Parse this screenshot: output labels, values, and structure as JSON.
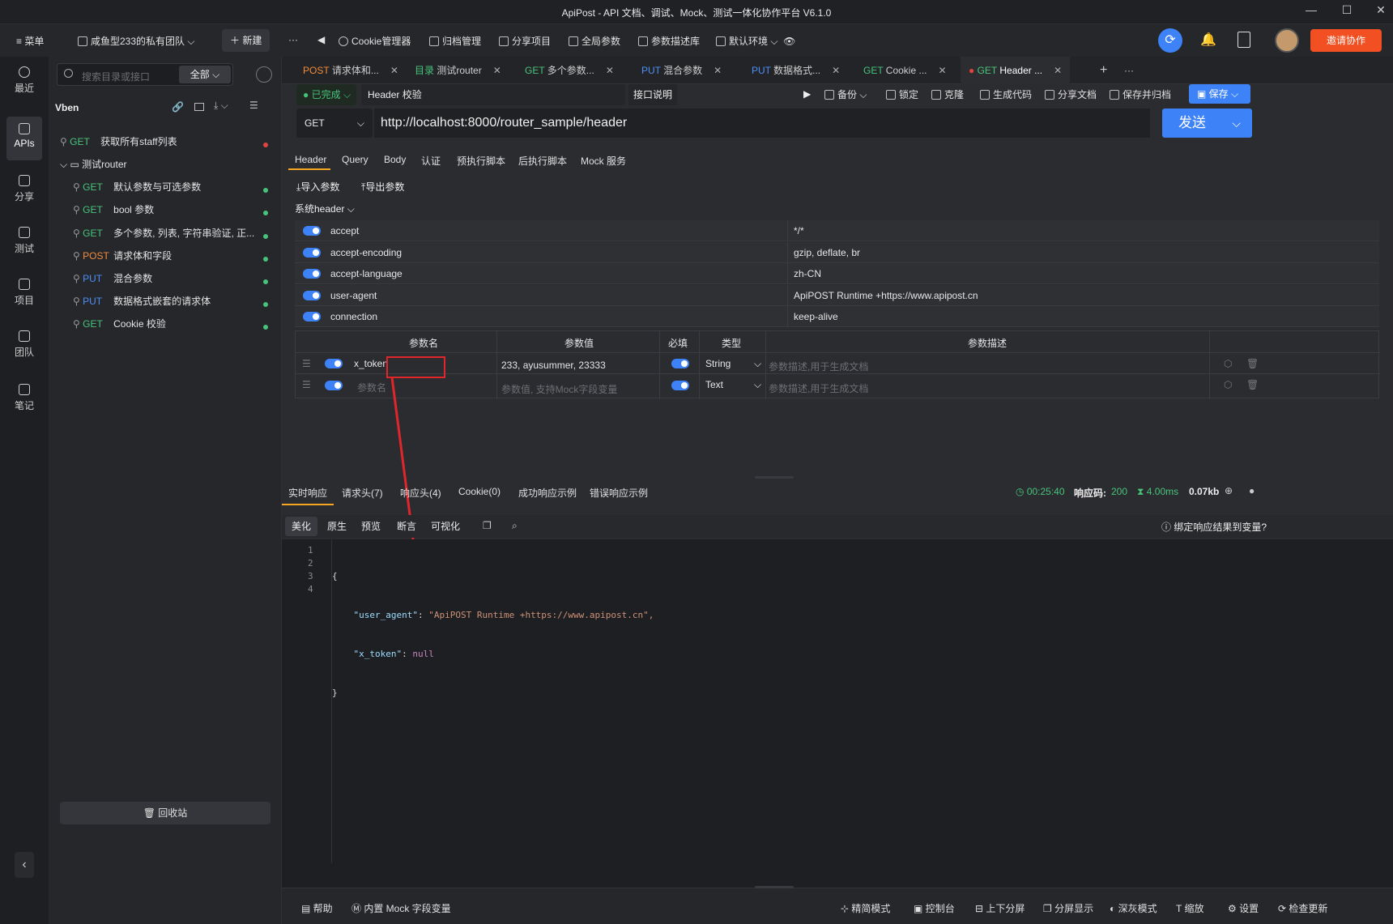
{
  "window": {
    "title": "ApiPost - API 文档、调试、Mock、测试一体化协作平台 V6.1.0"
  },
  "toolbar": {
    "menu": "菜单",
    "team": "咸鱼型233的私有团队",
    "new": "新建",
    "cookie": "Cookie管理器",
    "archive": "归档管理",
    "share_project": "分享项目",
    "global_params": "全局参数",
    "param_lib": "参数描述库",
    "env": "默认环境",
    "invite": "邀请协作"
  },
  "rail": [
    "最近",
    "APIs",
    "分享",
    "测试",
    "项目",
    "团队",
    "笔记"
  ],
  "sidebar": {
    "search_placeholder": "搜索目录或接口",
    "filter": "全部",
    "project": "Vben",
    "items": [
      {
        "method": "GET",
        "label": "获取所有staff列表",
        "dot": "#e0443e"
      },
      {
        "folder": "测试router"
      },
      {
        "method": "GET",
        "label": "默认参数与可选参数",
        "dot": "#47c47c"
      },
      {
        "method": "GET",
        "label": "bool 参数",
        "dot": "#47c47c"
      },
      {
        "method": "GET",
        "label": "多个参数, 列表, 字符串验证, 正...",
        "dot": "#47c47c"
      },
      {
        "method": "POST",
        "label": "请求体和字段",
        "dot": "#47c47c"
      },
      {
        "method": "PUT",
        "label": "混合参数",
        "dot": "#47c47c"
      },
      {
        "method": "PUT",
        "label": "数据格式嵌套的请求体",
        "dot": "#47c47c"
      },
      {
        "method": "GET",
        "label": "Cookie 校验",
        "dot": "#47c47c"
      }
    ],
    "trash": "回收站"
  },
  "tabs": [
    {
      "method": "POST",
      "label": "请求体和..."
    },
    {
      "method": "目录",
      "label": "测试router"
    },
    {
      "method": "GET",
      "label": "多个参数..."
    },
    {
      "method": "PUT",
      "label": "混合参数"
    },
    {
      "method": "PUT",
      "label": "数据格式..."
    },
    {
      "method": "GET",
      "label": "Cookie ..."
    },
    {
      "method": "GET",
      "label": "Header ..."
    }
  ],
  "request": {
    "status": "已完成",
    "name": "Header 校验",
    "doc": "接口说明",
    "actions": [
      "备份",
      "锁定",
      "克隆",
      "生成代码",
      "分享文档",
      "保存并归档"
    ],
    "save": "保存",
    "method": "GET",
    "url": "http://localhost:8000/router_sample/header",
    "send": "发送",
    "subtabs": [
      "Header",
      "Query",
      "Body",
      "认证",
      "预执行脚本",
      "后执行脚本",
      "Mock 服务"
    ],
    "import": "导入参数",
    "export": "导出参数",
    "sys_header": "系统header",
    "sys_headers": [
      {
        "k": "accept",
        "v": "*/*"
      },
      {
        "k": "accept-encoding",
        "v": "gzip, deflate, br"
      },
      {
        "k": "accept-language",
        "v": "zh-CN"
      },
      {
        "k": "user-agent",
        "v": "ApiPOST Runtime +https://www.apipost.cn"
      },
      {
        "k": "connection",
        "v": "keep-alive"
      }
    ],
    "cols": [
      "参数名",
      "参数值",
      "必填",
      "类型",
      "参数描述"
    ],
    "params": [
      {
        "name": "x_token",
        "value": "233, ayusummer, 23333",
        "type": "String",
        "desc": "参数描述,用于生成文档"
      },
      {
        "name": "参数名",
        "value": "参数值, 支持Mock字段变量",
        "type": "Text",
        "desc": "参数描述,用于生成文档"
      }
    ]
  },
  "response": {
    "tabs": [
      "实时响应",
      "请求头(7)",
      "响应头(4)",
      "Cookie(0)",
      "成功响应示例",
      "错误响应示例"
    ],
    "time": "00:25:40",
    "code_label": "响应码:",
    "code": "200",
    "duration": "4.00ms",
    "size": "0.07kb",
    "views": [
      "美化",
      "原生",
      "预览",
      "断言",
      "可视化"
    ],
    "bind": "绑定响应结果到变量?",
    "lines": [
      "1",
      "2",
      "3",
      "4"
    ],
    "body": {
      "l1": "{",
      "k2": "\"user_agent\"",
      "v2": "\"ApiPOST Runtime +https://www.apipost.cn\",",
      "k3": "\"x_token\"",
      "v3": "null",
      "l4": "}"
    }
  },
  "footer": {
    "left": [
      "帮助",
      "内置 Mock 字段变量"
    ],
    "right": [
      "精简模式",
      "控制台",
      "上下分屏",
      "分屏显示",
      "深灰模式",
      "缩放",
      "设置",
      "检查更新"
    ]
  },
  "colors": {
    "accent": "#3d82f6",
    "invite": "#f25022",
    "annotation": "#e0262b"
  }
}
